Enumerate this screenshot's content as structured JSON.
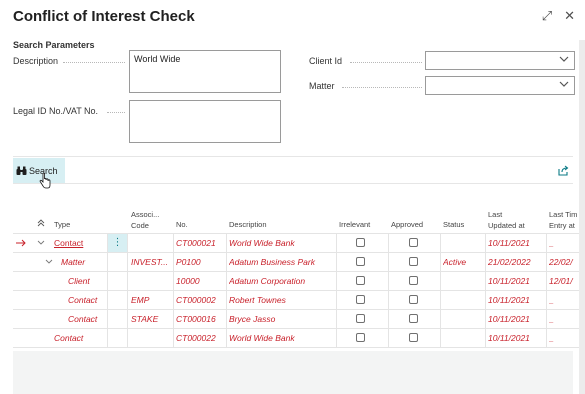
{
  "window": {
    "title": "Conflict of Interest Check",
    "expand_glyph": "⤢",
    "close_glyph": "✕"
  },
  "params": {
    "heading": "Search Parameters",
    "description_label": "Description",
    "description_value": "World Wide",
    "legal_id_label": "Legal ID No./VAT No.",
    "legal_id_value": "",
    "client_id_label": "Client Id",
    "client_id_value": "",
    "matter_label": "Matter",
    "matter_value": ""
  },
  "actions": {
    "search_label": "Search"
  },
  "grid": {
    "headers": {
      "type": "Type",
      "assoc_code": [
        "Associ...",
        "Code"
      ],
      "no": "No.",
      "description": "Description",
      "irrelevant": "Irrelevant",
      "approved": "Approved",
      "status": "Status",
      "last_updated": [
        "Last",
        "Updated at"
      ],
      "last_time": [
        "Last Tim",
        "Entry at"
      ]
    },
    "rows": [
      {
        "type": "Contact",
        "assoc": "",
        "no": "CT000021",
        "desc": "World Wide Bank",
        "status": "",
        "updated": "10/11/2021",
        "last": "_"
      },
      {
        "type": "Matter",
        "assoc": "INVEST...",
        "no": "P0100",
        "desc": "Adatum Business Park",
        "status": "Active",
        "updated": "21/02/2022",
        "last": "22/02/"
      },
      {
        "type": "Client",
        "assoc": "",
        "no": "10000",
        "desc": "Adatum Corporation",
        "status": "",
        "updated": "10/11/2021",
        "last": "12/01/"
      },
      {
        "type": "Contact",
        "assoc": "EMP",
        "no": "CT000002",
        "desc": "Robert Townes",
        "status": "",
        "updated": "10/11/2021",
        "last": "_"
      },
      {
        "type": "Contact",
        "assoc": "STAKE",
        "no": "CT000016",
        "desc": "Bryce Jasso",
        "status": "",
        "updated": "10/11/2021",
        "last": "_"
      },
      {
        "type": "Contact",
        "assoc": "",
        "no": "CT000022",
        "desc": "World Wide Bank",
        "status": "",
        "updated": "10/11/2021",
        "last": "_"
      }
    ]
  },
  "colors": {
    "accent": "#c8202a",
    "search_bg": "#d7eff3",
    "link_blue": "#00707a"
  },
  "icons": {
    "search": "binoculars-icon",
    "share": "share-icon",
    "row_arrow": "arrow-right-icon"
  }
}
